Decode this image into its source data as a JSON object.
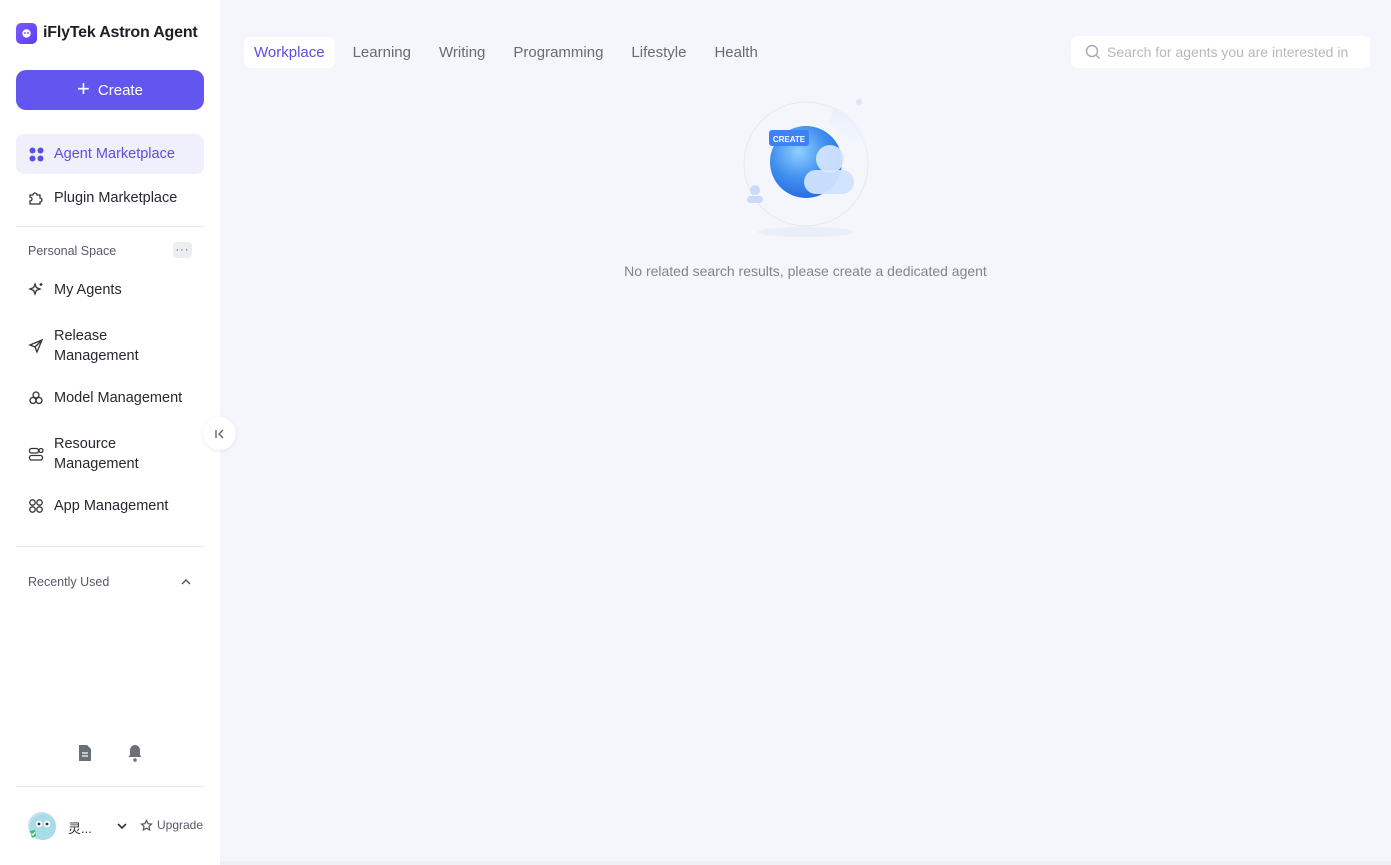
{
  "app": {
    "title": "iFlyTek Astron Agent"
  },
  "sidebar": {
    "create_label": "Create",
    "marketplace": [
      {
        "label": "Agent Marketplace",
        "icon": "grid-icon",
        "active": true
      },
      {
        "label": "Plugin Marketplace",
        "icon": "puzzle-icon",
        "active": false
      }
    ],
    "personal_space_title": "Personal Space",
    "more_label": "···",
    "personal": [
      {
        "label": "My Agents",
        "icon": "sparkle-icon"
      },
      {
        "label": "Release\nManagement",
        "icon": "send-icon"
      },
      {
        "label": "Model Management",
        "icon": "model-icon"
      },
      {
        "label": "Resource\nManagement",
        "icon": "resource-icon"
      },
      {
        "label": "App Management",
        "icon": "apps-icon"
      }
    ],
    "recently_used_title": "Recently Used",
    "user": {
      "name": "灵...",
      "upgrade_label": "Upgrade"
    }
  },
  "main": {
    "tabs": [
      {
        "label": "Workplace",
        "active": true
      },
      {
        "label": "Learning",
        "active": false
      },
      {
        "label": "Writing",
        "active": false
      },
      {
        "label": "Programming",
        "active": false
      },
      {
        "label": "Lifestyle",
        "active": false
      },
      {
        "label": "Health",
        "active": false
      }
    ],
    "search": {
      "placeholder": "Search for agents you are interested in",
      "value": ""
    },
    "empty_badge": "CREATE",
    "empty_message": "No related search results, please create a dedicated agent"
  },
  "colors": {
    "accent": "#6356f0",
    "active_text": "#5a4fe0",
    "background": "#f5f6fb"
  }
}
